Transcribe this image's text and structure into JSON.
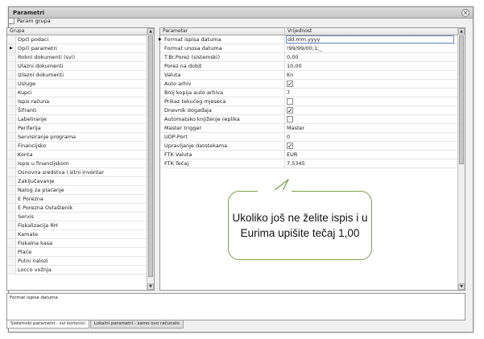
{
  "window": {
    "title": "Parametri",
    "close_glyph": "×"
  },
  "toolbar": {
    "param_grupa_label": "Param grupa",
    "param_grupa_checked": false
  },
  "left_grid": {
    "header": "Grupa",
    "current_index": 1,
    "items": [
      "Opći podaci",
      "Opći parametri",
      "Robni dokumenti (svi)",
      "Ulazni dokumenti",
      "Izlazni dokumenti",
      "Usluge",
      "Kupci",
      "Ispis računa",
      "Šifranti",
      "Labeliranje",
      "Periferija",
      "Servisiranje programa",
      "Financijsko",
      "Konta",
      "Ispis u financijskom",
      "Osnovna sredstva i sitni inventar",
      "Zaključavanje",
      "Nalog za plaćanje",
      "E Porezna",
      "E Porezna Ovlaštenik",
      "Servis",
      "Fiskalizacija RH",
      "Kamate",
      "Fiskalna kasa",
      "Plaće",
      "Putni nalozi",
      "Locco vožnja"
    ]
  },
  "right_grid": {
    "headers": {
      "param": "Parametar",
      "value": "Vrijednost"
    },
    "rows": [
      {
        "param": "Format ispisa datuma",
        "value": "dd.mm.yyyy",
        "type": "text",
        "current": true
      },
      {
        "param": "Format unosa datuma",
        "value": "!99/99/00;1;_",
        "type": "text"
      },
      {
        "param": "T.Br.Porez (sistemski)",
        "value": "0,00",
        "type": "text"
      },
      {
        "param": "Porez na dobit",
        "value": "10,00",
        "type": "text"
      },
      {
        "param": "Valuta",
        "value": "Kn",
        "type": "text"
      },
      {
        "param": "Auto arhiv",
        "checked": true,
        "type": "check"
      },
      {
        "param": "Broj kopija auto arhiva",
        "value": "7",
        "type": "text"
      },
      {
        "param": "Prikaz tekućeg mjeseca",
        "checked": false,
        "type": "check"
      },
      {
        "param": "Dnevnik događaja",
        "checked": true,
        "type": "check"
      },
      {
        "param": "Automatsko knjiženje replika",
        "checked": false,
        "type": "check"
      },
      {
        "param": "Master trigger",
        "value": "Master",
        "type": "text"
      },
      {
        "param": "UDP-Port",
        "value": "0",
        "type": "text"
      },
      {
        "param": "Upravljanje datotekama",
        "checked": true,
        "type": "check"
      },
      {
        "param": "FTK Valuta",
        "value": "EUR",
        "type": "text"
      },
      {
        "param": "FTK Tečaj",
        "value": "7,5345",
        "type": "text"
      }
    ]
  },
  "description": {
    "text": "Format ispisa datuma"
  },
  "tabs": [
    {
      "label": "Sistemski parametri - svi korisnici",
      "active": true
    },
    {
      "label": "Lokalni parametri - samo ovo računalo",
      "active": false
    }
  ],
  "callout": {
    "text": "Ukoliko još ne želite ispis i u Eurima upišite tečaj 1,00",
    "border_color": "#7aa04b"
  },
  "scroll_glyphs": {
    "up": "▲",
    "down": "▼"
  }
}
